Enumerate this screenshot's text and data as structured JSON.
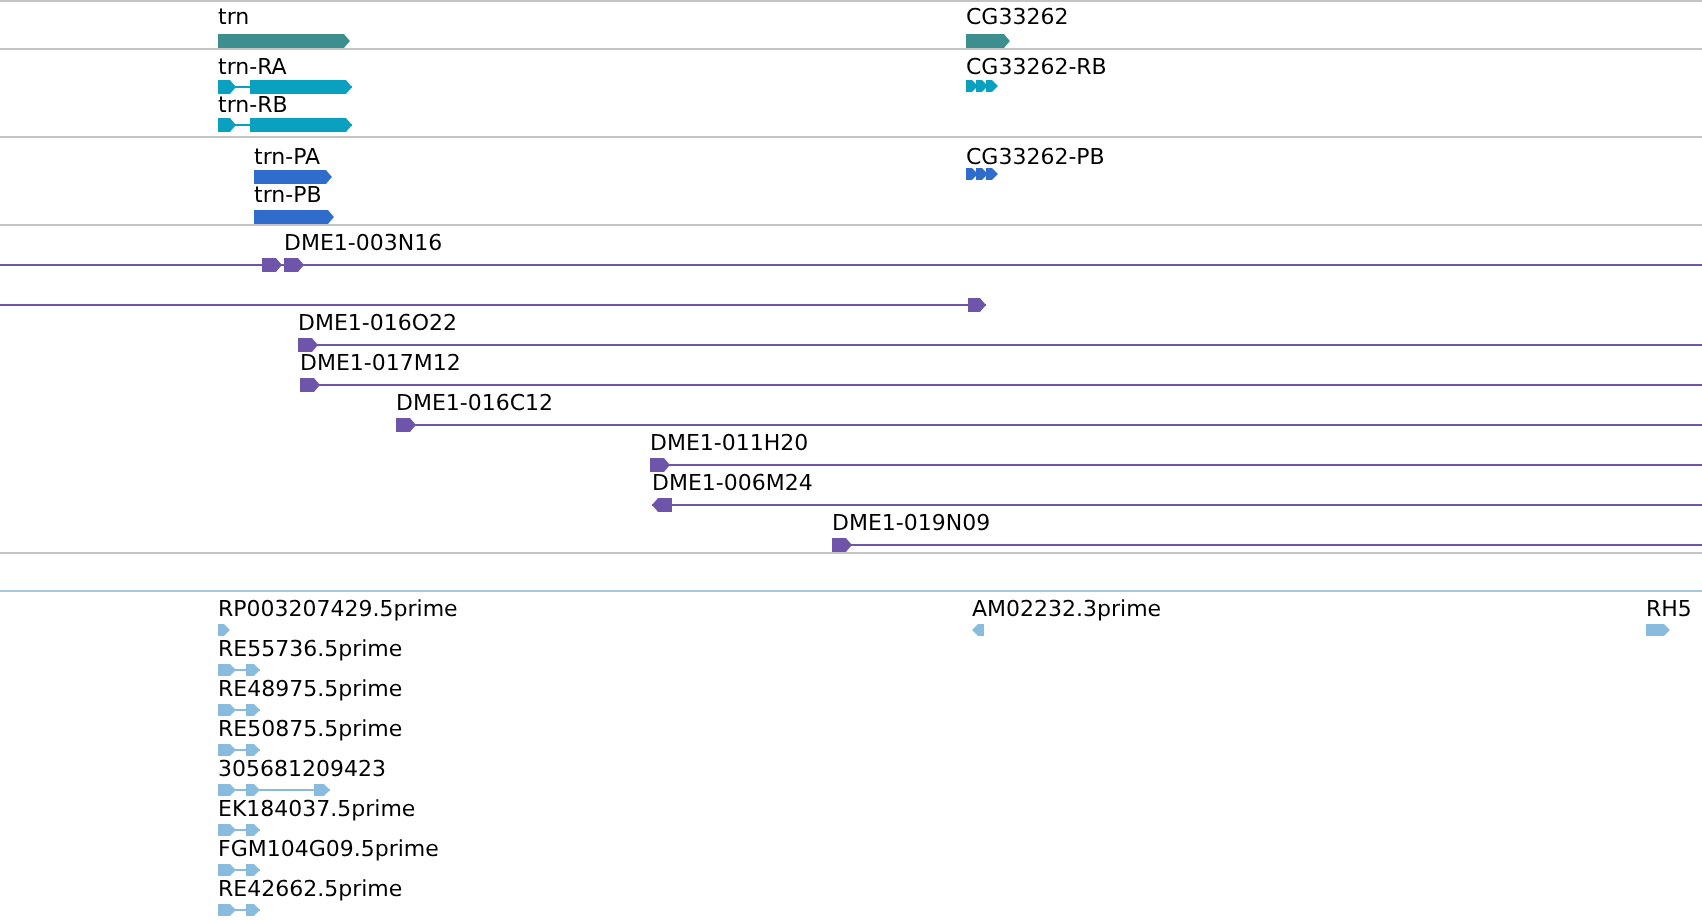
{
  "tracks": [
    {
      "kind": "gene",
      "color": "#3d8f8f",
      "features": [
        {
          "label": "trn",
          "reverse": false
        },
        {
          "label": "CG33262",
          "reverse": false
        }
      ]
    },
    {
      "kind": "transcript",
      "color": "#0aa0c0",
      "features": [
        {
          "label": "trn-RA",
          "reverse": false
        },
        {
          "label": "trn-RB",
          "reverse": false
        },
        {
          "label": "CG33262-RB",
          "reverse": false
        }
      ]
    },
    {
      "kind": "protein",
      "color": "#2f6ccc",
      "features": [
        {
          "label": "trn-PA",
          "reverse": false
        },
        {
          "label": "trn-PB",
          "reverse": false
        },
        {
          "label": "CG33262-PB",
          "reverse": false
        }
      ]
    },
    {
      "kind": "clone",
      "color": "#6f55aa",
      "features": [
        {
          "label": "DME1-003N16",
          "reverse": false
        },
        {
          "reverse": false
        },
        {
          "label": "DME1-016O22",
          "reverse": false
        },
        {
          "label": "DME1-017M12",
          "reverse": false
        },
        {
          "label": "DME1-016C12",
          "reverse": false
        },
        {
          "label": "DME1-011H20",
          "reverse": false
        },
        {
          "label": "DME1-006M24",
          "reverse": true
        },
        {
          "label": "DME1-019N09",
          "reverse": false
        }
      ]
    },
    {
      "kind": "est",
      "color": "#88bbdd",
      "features": [
        {
          "label": "RP003207429.5prime",
          "reverse": false
        },
        {
          "label": "RE55736.5prime",
          "reverse": false
        },
        {
          "label": "RE48975.5prime",
          "reverse": false
        },
        {
          "label": "RE50875.5prime",
          "reverse": false
        },
        {
          "label": "305681209423",
          "reverse": false
        },
        {
          "label": "EK184037.5prime",
          "reverse": false
        },
        {
          "label": "FGM104G09.5prime",
          "reverse": false
        },
        {
          "label": "RE42662.5prime",
          "reverse": false
        },
        {
          "label": "AM02232.3prime",
          "reverse": true
        },
        {
          "label": "RH5",
          "reverse": false
        }
      ]
    }
  ]
}
